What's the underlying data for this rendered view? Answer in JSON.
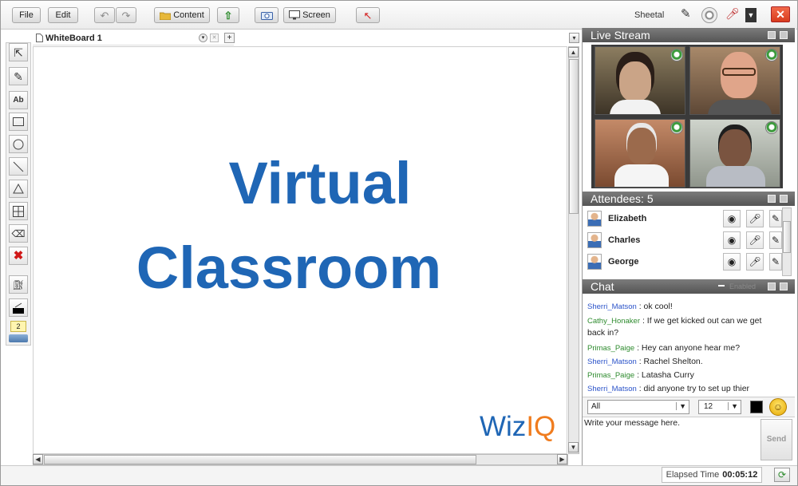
{
  "toolbar": {
    "file_label": "File",
    "edit_label": "Edit",
    "content_label": "Content",
    "screen_label": "Screen",
    "user_name": "Sheetal"
  },
  "whiteboard": {
    "tab_label": "WhiteBoard 1",
    "line1": "Virtual",
    "line2": "Classroom",
    "logo_wiz": "Wiz",
    "logo_iq": "IQ",
    "text_color": "#1f66b5",
    "logo_iq_color": "#f07c1e",
    "page_number": "2"
  },
  "live_stream": {
    "title": "Live Stream"
  },
  "attendees": {
    "title": "Attendees: 5",
    "list": [
      {
        "name": "Elizabeth"
      },
      {
        "name": "Charles"
      },
      {
        "name": "George"
      }
    ]
  },
  "chat": {
    "title": "Chat",
    "header_extra": "Enabled",
    "messages": [
      {
        "user": "Sherri_Matson",
        "sep": ":",
        "text": "ok cool!",
        "color": "blue"
      },
      {
        "user": "Cathy_Honaker",
        "sep": ":",
        "text": "If we get kicked out can we get back in?",
        "color": "green"
      },
      {
        "user": "Primas_Paige",
        "sep": ":",
        "text": "Hey can anyone hear me?",
        "color": "green"
      },
      {
        "user": "Sherri_Matson",
        "sep": ":",
        "text": "Rachel Shelton.",
        "color": "blue"
      },
      {
        "user": "Primas_Paige",
        "sep": ":",
        "text": "Latasha Curry",
        "color": "green"
      },
      {
        "user": "Sherri_Matson",
        "sep": ":",
        "text": "did anyone try to set up thier",
        "color": "blue"
      }
    ],
    "recipient_select": "All",
    "font_size_select": "12",
    "message_placeholder": "Write your message here.",
    "send_label": "Send"
  },
  "footer": {
    "elapsed_label": "Elapsed Time",
    "elapsed_value": "00:05:12"
  }
}
